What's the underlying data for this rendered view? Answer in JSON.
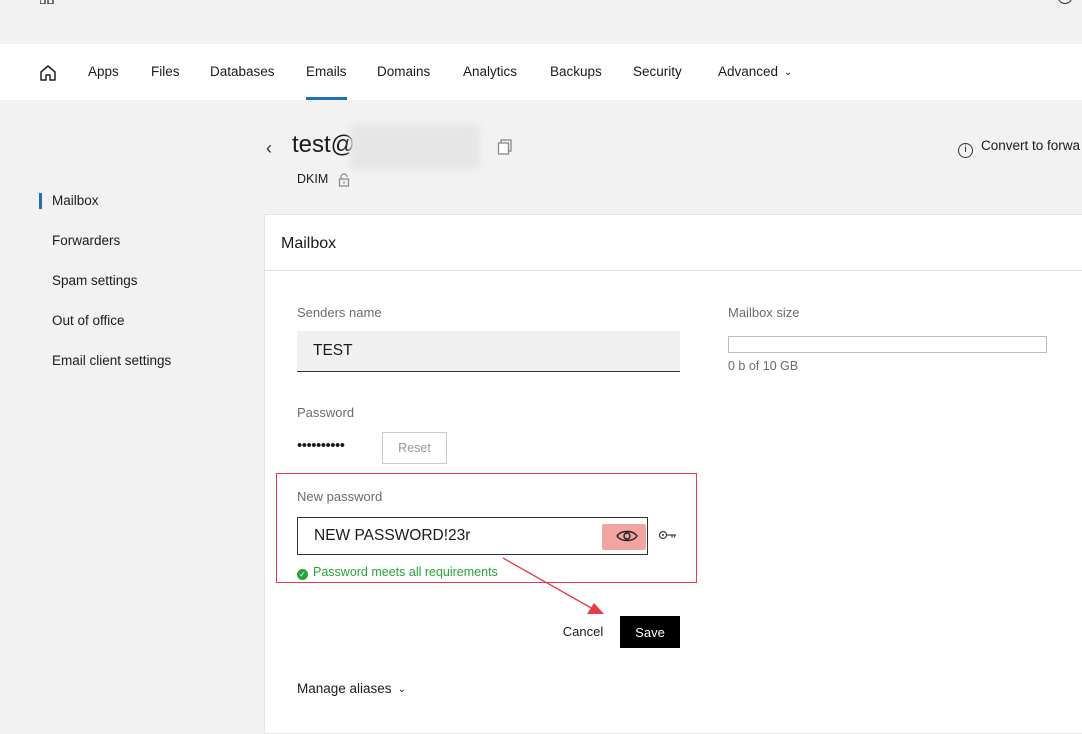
{
  "nav": {
    "items": [
      {
        "label": "Apps"
      },
      {
        "label": "Files"
      },
      {
        "label": "Databases"
      },
      {
        "label": "Emails"
      },
      {
        "label": "Domains"
      },
      {
        "label": "Analytics"
      },
      {
        "label": "Backups"
      },
      {
        "label": "Security"
      },
      {
        "label": "Advanced"
      }
    ],
    "active": "Emails",
    "accent_color": "#1f6fb5"
  },
  "sidebar": {
    "items": [
      {
        "label": "Mailbox"
      },
      {
        "label": "Forwarders"
      },
      {
        "label": "Spam settings"
      },
      {
        "label": "Out of office"
      },
      {
        "label": "Email client settings"
      }
    ],
    "active": "Mailbox"
  },
  "header": {
    "title": "test@",
    "dkim_label": "DKIM",
    "convert_label": "Convert to forwa"
  },
  "card": {
    "title": "Mailbox",
    "senders_name_label": "Senders name",
    "senders_name_value": "TEST",
    "password_label": "Password",
    "password_mask": "••••••••••",
    "reset_label": "Reset",
    "new_password_label": "New password",
    "new_password_value": "NEW PASSWORD!23r",
    "password_status": "Password meets all requirements",
    "cancel_label": "Cancel",
    "save_label": "Save",
    "manage_aliases_label": "Manage aliases",
    "mailbox_size_label": "Mailbox size",
    "mailbox_size_text": "0 b of 10 GB",
    "mailbox_usage_fraction": 0
  },
  "icons": {
    "home": "home-icon",
    "copy": "copy-icon",
    "lock": "lock-icon",
    "info": "info-icon",
    "eye": "eye-icon",
    "key": "key-icon",
    "check": "check-circle-icon",
    "chevron": "chevron-down-icon",
    "back": "chevron-left-icon"
  },
  "colors": {
    "success": "#27a33a",
    "highlight": "#e63b4a",
    "save_button": "#000000"
  }
}
